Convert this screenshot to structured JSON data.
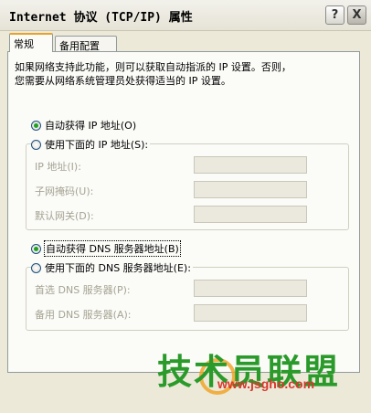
{
  "window": {
    "title": "Internet 协议 (TCP/IP) 属性",
    "help_glyph": "?",
    "close_glyph": "X"
  },
  "tabs": [
    {
      "label": "常规",
      "active": true
    },
    {
      "label": "备用配置",
      "active": false
    }
  ],
  "description": {
    "line1": "如果网络支持此功能，则可以获取自动指派的 IP 设置。否则，",
    "line2": "您需要从网络系统管理员处获得适当的 IP 设置。"
  },
  "ip_mode": {
    "auto_label": "自动获得 IP 地址(O)",
    "auto_selected": true,
    "manual_label": "使用下面的 IP 地址(S):",
    "manual_selected": false
  },
  "ip_fields": [
    {
      "label": "IP 地址(I):",
      "value": ""
    },
    {
      "label": "子网掩码(U):",
      "value": ""
    },
    {
      "label": "默认网关(D):",
      "value": ""
    }
  ],
  "dns_mode": {
    "auto_label": "自动获得 DNS 服务器地址(B)",
    "auto_selected": true,
    "manual_label": "使用下面的 DNS 服务器地址(E):",
    "manual_selected": false
  },
  "dns_fields": [
    {
      "label": "首选 DNS 服务器(P):",
      "value": ""
    },
    {
      "label": "备用 DNS 服务器(A):",
      "value": ""
    }
  ],
  "watermark": {
    "text": "技术员联盟",
    "url": "www.jsgho.com"
  }
}
